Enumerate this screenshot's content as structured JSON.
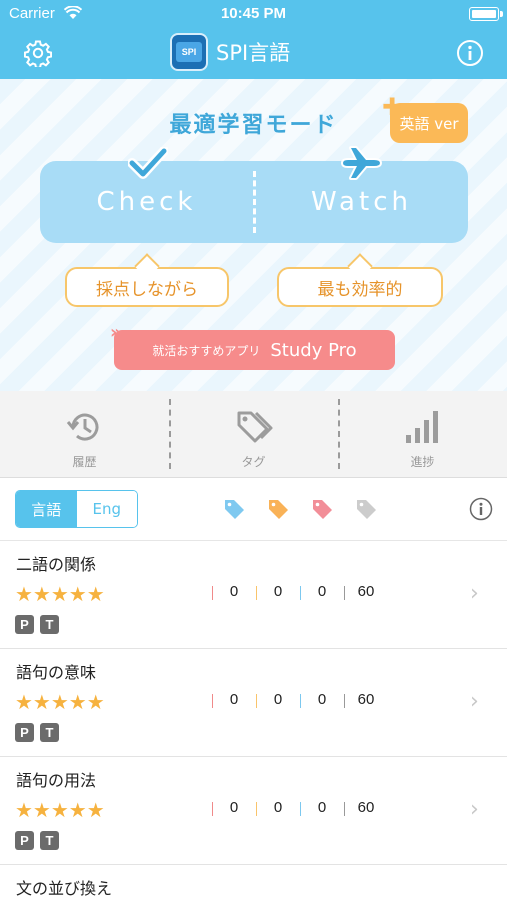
{
  "status": {
    "carrier": "Carrier",
    "time": "10:45 PM"
  },
  "nav": {
    "title": "SPI言語",
    "logo_text": "SPI"
  },
  "hero": {
    "mode_title": "最適学習モード",
    "english_badge": "英語 ver",
    "check_label": "Check",
    "watch_label": "Watch",
    "check_caption": "採点しながら",
    "watch_caption": "最も効率的",
    "promo_small": "就活おすすめアプリ",
    "promo_large": "Study Pro"
  },
  "tools": [
    {
      "label": "履歴",
      "icon": "history-icon"
    },
    {
      "label": "タグ",
      "icon": "tags-icon"
    },
    {
      "label": "進捗",
      "icon": "progress-bars-icon"
    }
  ],
  "filter": {
    "segments": [
      "言語",
      "Eng"
    ],
    "selected": "言語",
    "tag_colors": [
      "#7fc9f0",
      "#f9b257",
      "#f28e98",
      "#cccccc"
    ]
  },
  "categories": [
    {
      "title": "二語の関係",
      "rating": 5,
      "stars": "★★★★★",
      "counts": [
        "0",
        "0",
        "0",
        "60"
      ],
      "badges": [
        "P",
        "T"
      ]
    },
    {
      "title": "語句の意味",
      "rating": 5,
      "stars": "★★★★★",
      "counts": [
        "0",
        "0",
        "0",
        "60"
      ],
      "badges": [
        "P",
        "T"
      ]
    },
    {
      "title": "語句の用法",
      "rating": 5,
      "stars": "★★★★★",
      "counts": [
        "0",
        "0",
        "0",
        "60"
      ],
      "badges": [
        "P",
        "T"
      ]
    },
    {
      "title": "文の並び換え"
    }
  ],
  "colors": {
    "accent": "#57c3ec",
    "orange": "#fbb957",
    "pink": "#f68b8b",
    "star": "#f6b23f",
    "count_separators": [
      "#f08a8a",
      "#f9c46b",
      "#7cc8ef",
      "#999999"
    ]
  }
}
